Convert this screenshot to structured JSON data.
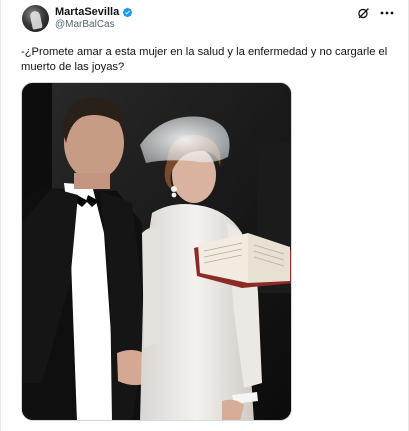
{
  "user": {
    "display_name": "MartaSevilla",
    "handle": "@MarBalCas",
    "verified_color": "#1d9bf0"
  },
  "header": {
    "icons": [
      "grok-icon",
      "more-icon"
    ]
  },
  "tweet": {
    "text": "-¿Promete amar a esta mujer en la salud y la enfermedad y no cargarle el muerto de las joyas?"
  },
  "media": {
    "kind": "photo",
    "subject": "man-in-tuxedo-and-bride-in-white-with-veil-holding-book"
  }
}
